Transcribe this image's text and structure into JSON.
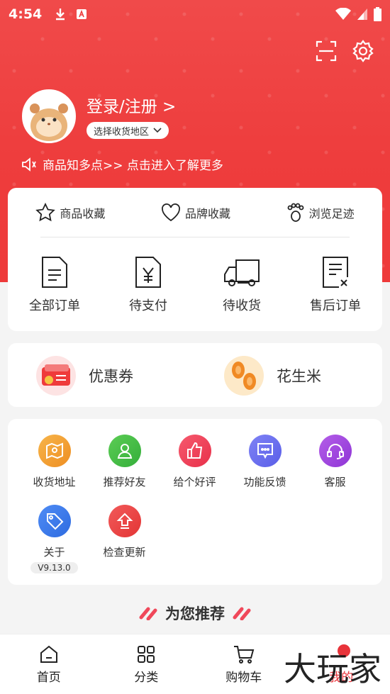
{
  "status_bar": {
    "time": "4:54"
  },
  "header": {
    "login_label": "登录/注册 >",
    "region_label": "选择收货地区",
    "notice_text": "商品知多点>> 点击进入了解更多"
  },
  "favorites": [
    {
      "label": "商品收藏",
      "icon": "star-icon"
    },
    {
      "label": "品牌收藏",
      "icon": "heart-icon"
    },
    {
      "label": "浏览足迹",
      "icon": "footprint-icon"
    }
  ],
  "orders": [
    {
      "label": "全部订单",
      "icon": "list-doc-icon"
    },
    {
      "label": "待支付",
      "icon": "yen-doc-icon"
    },
    {
      "label": "待收货",
      "icon": "truck-icon"
    },
    {
      "label": "售后订单",
      "icon": "refund-doc-icon"
    }
  ],
  "promos": [
    {
      "label": "优惠券",
      "icon": "coupon-icon"
    },
    {
      "label": "花生米",
      "icon": "peanut-icon"
    }
  ],
  "tools": [
    {
      "label": "收货地址",
      "icon": "map-icon",
      "color": "#f2a23a"
    },
    {
      "label": "推荐好友",
      "icon": "friends-icon",
      "color": "#4cbf4a"
    },
    {
      "label": "给个好评",
      "icon": "thumbs-up-icon",
      "color": "#f0435b"
    },
    {
      "label": "功能反馈",
      "icon": "feedback-icon",
      "color": "#6b6ff0"
    },
    {
      "label": "客服",
      "icon": "headset-icon",
      "color": "#a64ae0"
    },
    {
      "label": "关于",
      "icon": "tag-icon",
      "color": "#3d7cf0"
    },
    {
      "label": "检查更新",
      "icon": "upload-icon",
      "color": "#ef4747"
    }
  ],
  "about_version": "V9.13.0",
  "recommend_title": "为您推荐",
  "bottom_nav": [
    {
      "label": "首页",
      "icon": "home-icon"
    },
    {
      "label": "分类",
      "icon": "grid-icon"
    },
    {
      "label": "购物车",
      "icon": "cart-icon"
    },
    {
      "label": "我的",
      "icon": "profile-icon"
    }
  ],
  "watermark": "大玩家",
  "colors": {
    "brand_red": "#ee3d3d",
    "active_tab": "#e8333a"
  }
}
